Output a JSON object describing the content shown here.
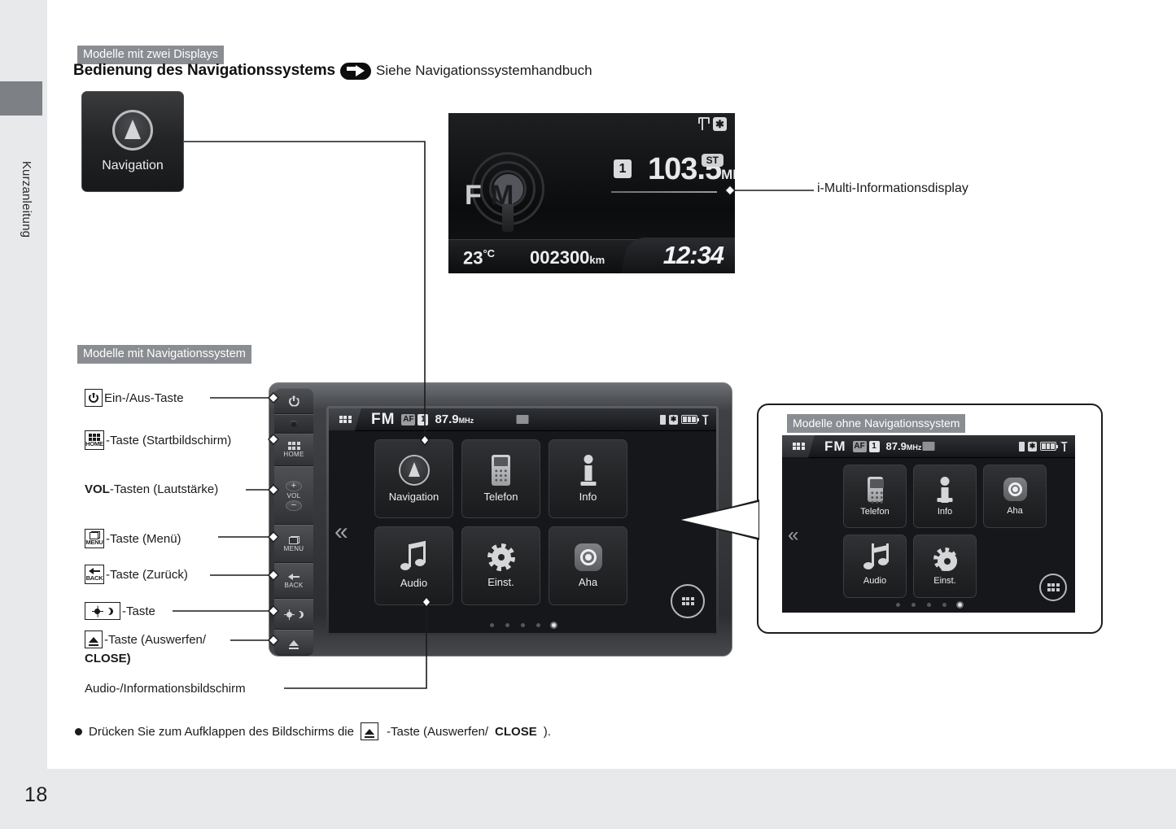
{
  "sidebar": {
    "tab_label": "Kurzanleitung"
  },
  "page": {
    "number": "18"
  },
  "section_two_displays": {
    "badge": "Modelle mit zwei Displays",
    "heading": "Bedienung des Navigationssystems",
    "arrow_icon": "arrow-right-pill-icon",
    "reference": "Siehe Navigationssystemhandbuch"
  },
  "nav_thumb": {
    "icon": "compass-icon",
    "label": "Navigation"
  },
  "imid": {
    "callout_label": "i-Multi-Informationsdisplay",
    "icons": {
      "usb": "usb-icon",
      "bluetooth": "bluetooth-icon"
    },
    "band": "FM",
    "preset": "1",
    "frequency": "103.5",
    "frequency_unit": "MHz",
    "stereo_badge": "ST",
    "temperature": "23",
    "temperature_unit": "°C",
    "odometer": "002300",
    "odometer_unit": "km",
    "clock": "12:34"
  },
  "section_with_nav": {
    "badge": "Modelle mit Navigationssystem",
    "callouts": [
      {
        "icon": "power-icon",
        "text": "Ein-/Aus-Taste"
      },
      {
        "icon": "home-grid-icon",
        "text": "-Taste (Startbildschirm)"
      },
      {
        "icon": "vol-text-icon",
        "text": "VOL",
        "text2": "-Tasten (Lautstärke)"
      },
      {
        "icon": "menu-icon",
        "text": "-Taste (Menü)"
      },
      {
        "icon": "back-icon",
        "text": "-Taste (Zurück)"
      },
      {
        "icon": "brightness-icon",
        "text": "-Taste"
      },
      {
        "icon": "eject-icon",
        "text": "-Taste (Auswerfen/",
        "text2": "CLOSE)"
      }
    ],
    "audio_screen_label": "Audio-/Informationsbildschirm"
  },
  "hardware_buttons": [
    {
      "name": "power-button",
      "label": ""
    },
    {
      "name": "sensor",
      "label": ""
    },
    {
      "name": "home-button",
      "label": "HOME"
    },
    {
      "name": "volume-buttons",
      "label": "VOL"
    },
    {
      "name": "menu-button",
      "label": "MENU"
    },
    {
      "name": "back-button",
      "label": "BACK"
    },
    {
      "name": "brightness-button",
      "label": ""
    },
    {
      "name": "eject-button",
      "label": ""
    }
  ],
  "screen": {
    "statusbar": {
      "home_icon": "home-grid-icon",
      "band": "FM",
      "af": "AF",
      "preset": "1",
      "frequency": "87.9",
      "frequency_unit": "MHz",
      "picture_icon": "picture-icon",
      "usb_icon": "usb-icon",
      "bluetooth_icon": "bluetooth-icon",
      "battery_icon": "battery-icon",
      "signal_icon": "signal-icon"
    },
    "chevron": "«",
    "tiles": [
      {
        "icon": "compass-icon",
        "label": "Navigation"
      },
      {
        "icon": "phone-icon",
        "label": "Telefon"
      },
      {
        "icon": "info-icon",
        "label": "Info"
      },
      {
        "icon": "music-note-icon",
        "label": "Audio"
      },
      {
        "icon": "gear-icon",
        "label": "Einst."
      },
      {
        "icon": "aha-icon",
        "label": "Aha"
      }
    ],
    "apps_button_icon": "apps-grid-icon",
    "page_dots": {
      "count": 5,
      "active_index": 4
    }
  },
  "inset_without_nav": {
    "badge": "Modelle ohne Navigationssystem",
    "statusbar": {
      "band": "FM",
      "af": "AF",
      "preset": "1",
      "frequency": "87.9",
      "frequency_unit": "MHz"
    },
    "chevron": "«",
    "tiles": [
      {
        "icon": "phone-icon",
        "label": "Telefon"
      },
      {
        "icon": "info-icon",
        "label": "Info"
      },
      {
        "icon": "aha-icon",
        "label": "Aha"
      },
      {
        "icon": "music-note-icon",
        "label": "Audio"
      },
      {
        "icon": "gear-icon",
        "label": "Einst."
      }
    ],
    "apps_button_icon": "apps-grid-icon",
    "page_dots": {
      "count": 5,
      "active_index": 4
    }
  },
  "bottom_note": {
    "bullet": "●",
    "text_before": "Drücken Sie zum Aufklappen des Bildschirms die",
    "icon": "eject-icon",
    "text_after": "-Taste (Auswerfen/",
    "text_bold": "CLOSE",
    "text_end": ")."
  },
  "colors": {
    "badge_gray": "#8a8d91",
    "page_bg": "#e8e9ea",
    "paper": "#ffffff",
    "ink": "#1b1b1b"
  }
}
